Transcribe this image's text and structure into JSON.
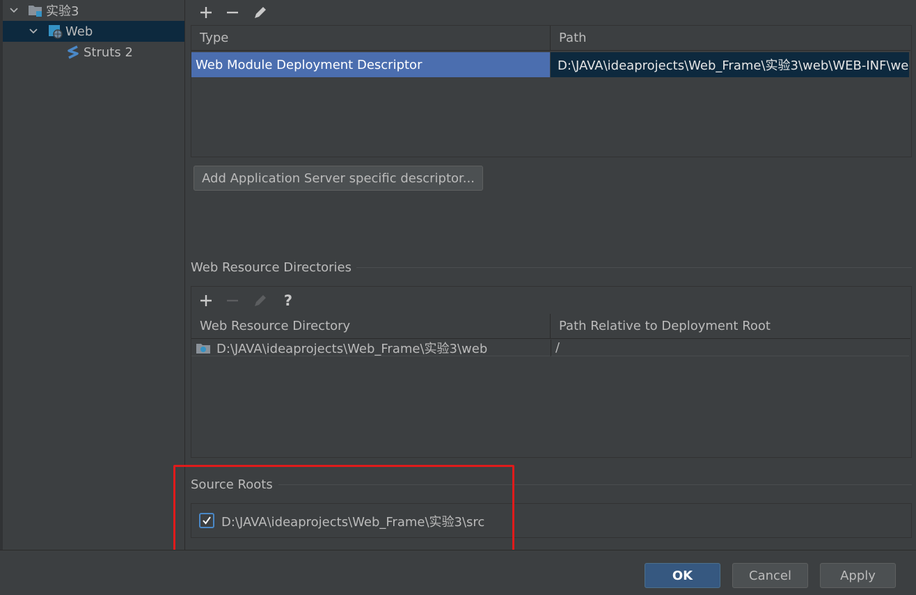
{
  "tree": {
    "items": [
      {
        "label": "实验3",
        "icon": "folder-module-icon"
      },
      {
        "label": "Web",
        "icon": "web-facet-icon"
      },
      {
        "label": "Struts 2",
        "icon": "struts-icon"
      }
    ]
  },
  "descriptors": {
    "toolbar": [
      "add",
      "remove",
      "edit"
    ],
    "columns": [
      "Type",
      "Path"
    ],
    "rows": [
      {
        "type": "Web Module Deployment Descriptor",
        "path": "D:\\JAVA\\ideaprojects\\Web_Frame\\实验3\\web\\WEB-INF\\we"
      }
    ],
    "add_server_button": "Add Application Server specific descriptor..."
  },
  "web_resources": {
    "title": "Web Resource Directories",
    "toolbar": [
      "add",
      "remove",
      "edit",
      "help"
    ],
    "help_label": "?",
    "columns": [
      "Web Resource Directory",
      "Path Relative to Deployment Root"
    ],
    "rows": [
      {
        "directory": "D:\\JAVA\\ideaprojects\\Web_Frame\\实验3\\web",
        "relative": "/"
      }
    ]
  },
  "source_roots": {
    "title": "Source Roots",
    "items": [
      {
        "checked": true,
        "path": "D:\\JAVA\\ideaprojects\\Web_Frame\\实验3\\src"
      }
    ]
  },
  "footer": {
    "ok": "OK",
    "cancel": "Cancel",
    "apply": "Apply"
  },
  "colors": {
    "background": "#3c3f41",
    "selection": "#4b6eaf",
    "highlight_border": "#e01b1b",
    "default_button": "#365880"
  }
}
